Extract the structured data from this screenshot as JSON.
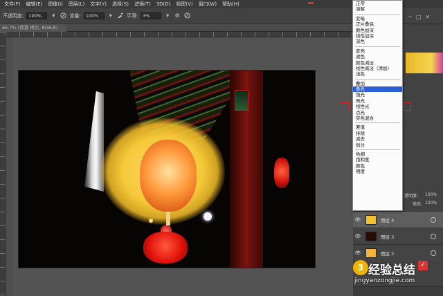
{
  "menu": [
    "文件(F)",
    "编辑(E)",
    "图像(I)",
    "图层(L)",
    "文字(Y)",
    "选择(S)",
    "滤镜(T)",
    "3D(D)",
    "视图(V)",
    "窗口(W)",
    "帮助(H)"
  ],
  "options": {
    "opacity_label": "不透明度:",
    "opacity_value": "100%",
    "flow_label": "流量:",
    "flow_value": "100%",
    "smooth_label": "平滑:",
    "smooth_value": "3%"
  },
  "tab": {
    "title": "66.7% (背景 拷贝, RGB/8) *",
    "close": "×"
  },
  "blend_modes": [
    [
      "正常",
      "溶解"
    ],
    [
      "变暗",
      "正片叠底",
      "颜色加深",
      "线性加深",
      "深色"
    ],
    [
      "变亮",
      "滤色",
      "颜色减淡",
      "线性减淡（添加）",
      "浅色"
    ],
    [
      "叠加",
      "柔光",
      "强光",
      "亮光",
      "线性光",
      "点光",
      "实色混合"
    ],
    [
      "差值",
      "排除",
      "减去",
      "划分"
    ],
    [
      "色相",
      "饱和度",
      "颜色",
      "明度"
    ]
  ],
  "selected_blend_mode": "柔光",
  "layers_panel": {
    "opacity_label": "透明度:",
    "fill_label": "填充:",
    "opacity_value": "100%",
    "fill_value": "100%"
  },
  "layers": [
    {
      "name": "图层 4",
      "thumb": "#f0c030",
      "active": true
    },
    {
      "name": "图层 3",
      "thumb": "#2a0c06",
      "active": false
    },
    {
      "name": "图层 2",
      "thumb": "#f2b43a",
      "active": false
    }
  ],
  "watermark": {
    "logo": "3",
    "cn": "经验总结",
    "check": "✓",
    "url": "jingyanzongjie.com"
  },
  "colors": {
    "selection": "#2a5fd1",
    "highlight_box": "#e02020",
    "swatch": "#e9b829"
  }
}
